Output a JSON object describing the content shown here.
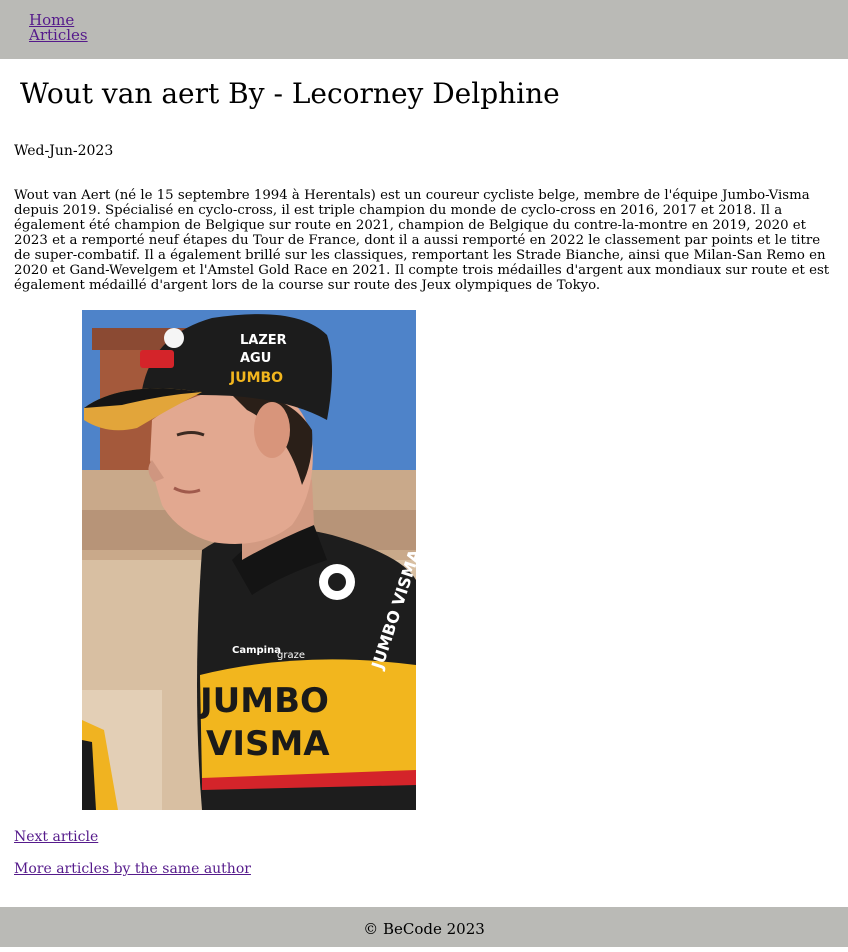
{
  "nav": {
    "items": [
      {
        "label": "Home"
      },
      {
        "label": "Articles"
      }
    ]
  },
  "article": {
    "title": "Wout van aert By - Lecorney Delphine",
    "date": "Wed-Jun-2023",
    "content": "Wout van Aert (né le 15 septembre 1994 à Herentals) est un coureur cycliste belge, membre de l'équipe Jumbo-Visma depuis 2019. Spécialisé en cyclo-cross, il est triple champion du monde de cyclo-cross en 2016, 2017 et 2018. Il a également été champion de Belgique sur route en 2021, champion de Belgique du contre-la-montre en 2019, 2020 et 2023 et a remporté neuf étapes du Tour de France, dont il a aussi remporté en 2022 le classement par points et le titre de super-combatif. Il a également brillé sur les classiques, remportant les Strade Bianche, ainsi que Milan-San Remo en 2020 et Gand-Wevelgem et l'Amstel Gold Race en 2021. Il compte trois médailles d'argent aux mondiaux sur route et est également médaillé d'argent lors de la course sur route des Jeux olympiques de Tokyo.",
    "photo": {
      "cap_text": [
        "LAZER",
        "AGU",
        "JUMBO"
      ],
      "jersey_text": [
        "JUMBO",
        "VISMA",
        "JUMBO VISMA",
        "graze",
        "Campina"
      ]
    },
    "links": {
      "next": "Next article",
      "more_by_author": "More articles by the same author"
    }
  },
  "footer": {
    "text": "© BeCode 2023"
  },
  "colors": {
    "header_bg": "#babab6",
    "footer_bg": "#babab6",
    "link": "#551a8b",
    "sky": "#4b80c8",
    "brick": "#a55a3c",
    "jersey_black": "#1b1b1b",
    "jersey_yellow": "#f2b61e",
    "jersey_red": "#d4242a"
  }
}
